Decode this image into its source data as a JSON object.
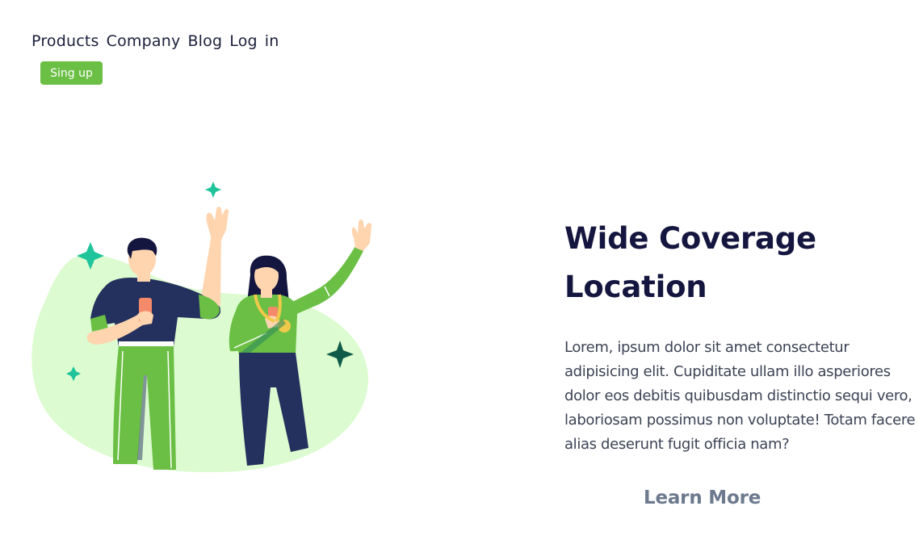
{
  "nav": {
    "items": [
      {
        "label": "Products"
      },
      {
        "label": "Company"
      },
      {
        "label": "Blog"
      },
      {
        "label": "Log"
      },
      {
        "label": "in"
      }
    ],
    "signup_label": "Sing up"
  },
  "hero": {
    "title_line1": "Wide Coverage",
    "title_line2": "Location",
    "body": "Lorem, ipsum dolor sit amet consectetur adipisicing elit. Cupiditate ullam illo asperiores dolor eos debitis quibusdam distinctio sequi vero, laboriosam possimus non voluptate! Totam facere alias deserunt fugit officia nam?",
    "cta_label": "Learn More"
  },
  "illustration": {
    "icons": [
      "sparkle-icon",
      "waving-people-illustration"
    ]
  },
  "colors": {
    "accent": "#6bbf45",
    "blob": "#dcfbd0",
    "navy": "#15163f",
    "sparkle_light": "#1fc49a",
    "sparkle_dark": "#0f5a48"
  }
}
